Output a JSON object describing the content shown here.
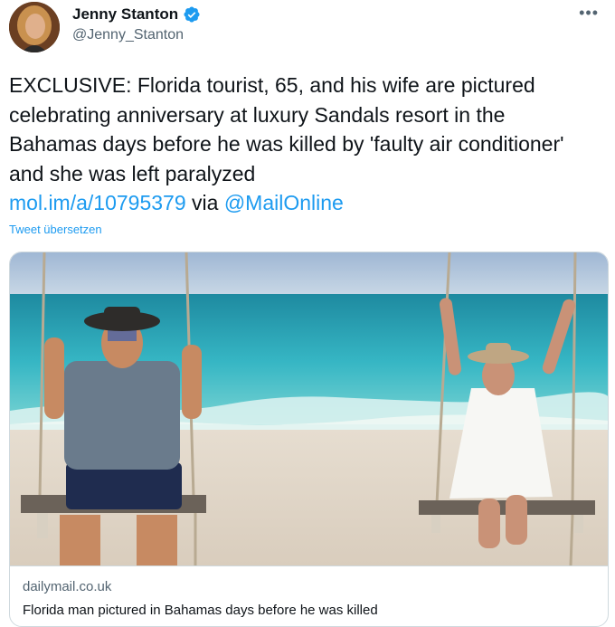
{
  "author": {
    "display_name": "Jenny Stanton",
    "handle": "@Jenny_Stanton",
    "verified": true
  },
  "menu_icon": "more-horizontal-icon",
  "tweet": {
    "text_main": "EXCLUSIVE: Florida tourist, 65, and his wife are pictured celebrating anniversary at luxury Sandals resort in the Bahamas days before he was killed by 'faulty air conditioner' and she was left paralyzed",
    "link_text": "mol.im/a/10795379",
    "via_text": "via",
    "mention_text": "@MailOnline"
  },
  "translate_label": "Tweet übersetzen",
  "card": {
    "domain": "dailymail.co.uk",
    "title": "Florida man pictured in Bahamas days before he was killed"
  },
  "colors": {
    "link": "#1d9bf0",
    "verified": "#1d9bf0",
    "secondary_text": "#536471",
    "border": "#cfd9de"
  }
}
